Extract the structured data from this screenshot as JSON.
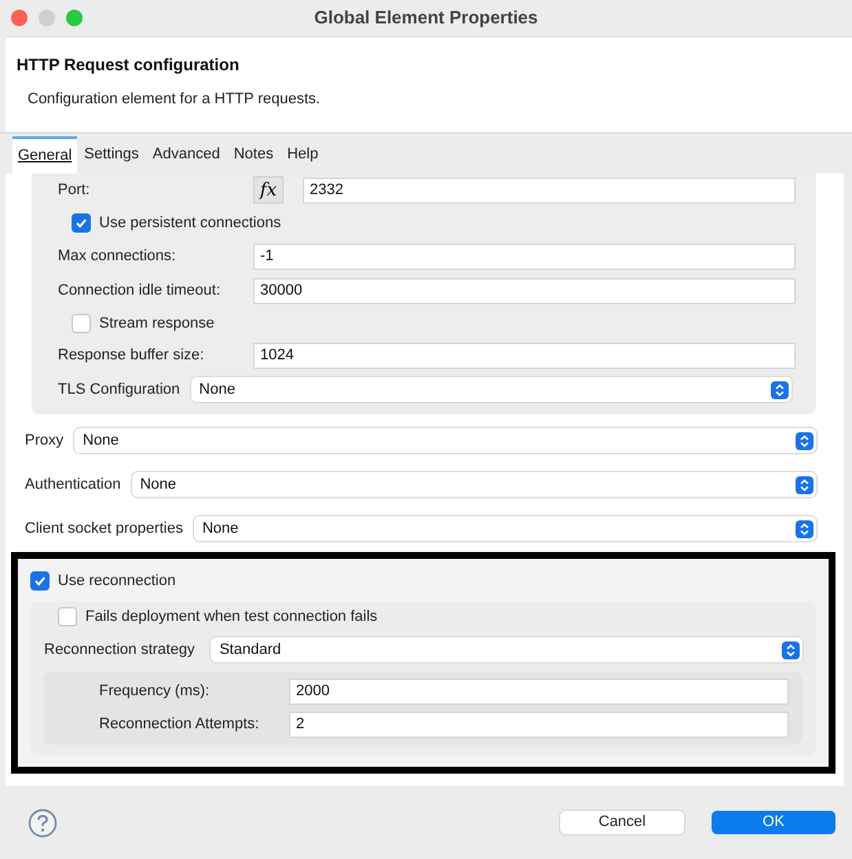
{
  "window": {
    "title": "Global Element Properties"
  },
  "header": {
    "title": "HTTP Request configuration",
    "description": "Configuration element for a HTTP requests."
  },
  "tabs": [
    {
      "label": "General",
      "selected": true
    },
    {
      "label": "Settings",
      "selected": false
    },
    {
      "label": "Advanced",
      "selected": false
    },
    {
      "label": "Notes",
      "selected": false
    },
    {
      "label": "Help",
      "selected": false
    }
  ],
  "connection_group": [
    {
      "kind": "expression",
      "label": "Port:",
      "button": "fx",
      "value": "2332"
    },
    {
      "kind": "checkbox",
      "label": "Use persistent connections",
      "checked": true
    },
    {
      "kind": "field",
      "label": "Max connections:",
      "value": "-1"
    },
    {
      "kind": "field",
      "label": "Connection idle timeout:",
      "value": "30000"
    },
    {
      "kind": "checkbox",
      "label": "Stream response",
      "checked": false
    },
    {
      "kind": "field",
      "label": "Response buffer size:",
      "value": "1024"
    },
    {
      "kind": "select",
      "label": "TLS Configuration",
      "value": "None"
    }
  ],
  "selects": [
    {
      "label": "Proxy",
      "value": "None"
    },
    {
      "label": "Authentication",
      "value": "None"
    },
    {
      "label": "Client socket properties",
      "value": "None"
    }
  ],
  "reconnection": {
    "label": "Use reconnection",
    "checked": true,
    "fails_deployment": {
      "label": "Fails deployment when test connection fails",
      "checked": false
    },
    "strategy": {
      "label": "Reconnection strategy",
      "value": "Standard"
    },
    "fields": [
      {
        "label": "Frequency (ms):",
        "value": "2000"
      },
      {
        "label": "Reconnection Attempts:",
        "value": "2"
      }
    ]
  },
  "footer": {
    "buttons": [
      {
        "label": "Cancel",
        "kind": "secondary"
      },
      {
        "label": "OK",
        "kind": "primary"
      }
    ]
  }
}
